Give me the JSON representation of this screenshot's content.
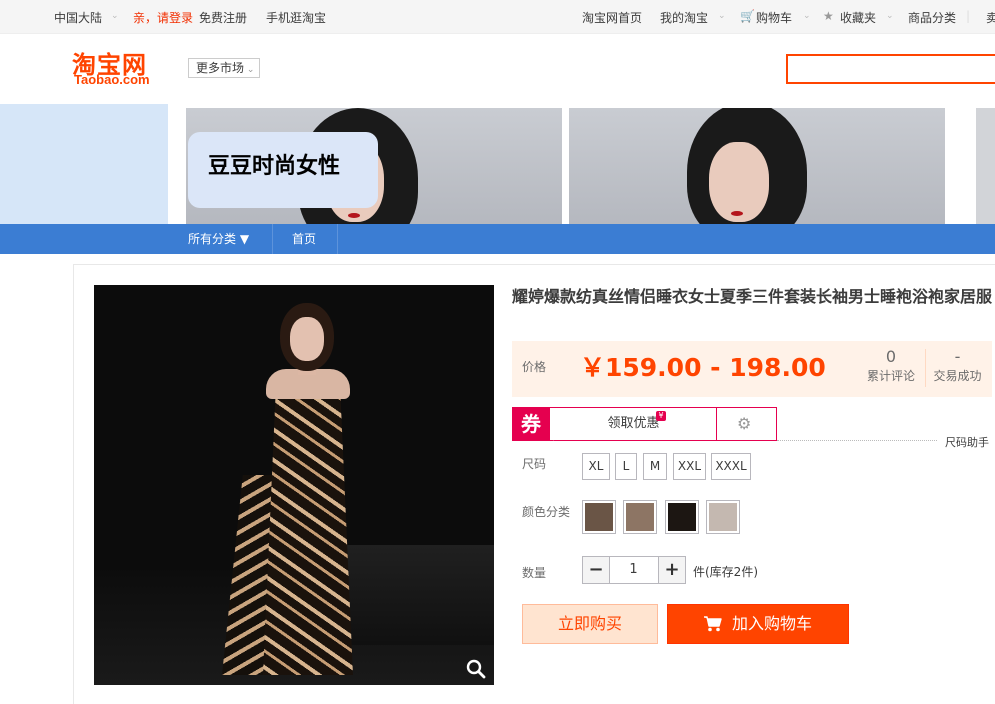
{
  "sitenav": {
    "region": "中国大陆",
    "login": "亲，请登录",
    "register": "免费注册",
    "mobile": "手机逛淘宝",
    "home": "淘宝网首页",
    "my_taobao": "我的淘宝",
    "cart": "购物车",
    "favorites": "收藏夹",
    "categories": "商品分类",
    "more": "卖"
  },
  "header": {
    "logo_cn": "淘宝网",
    "logo_en": "Taobao.com",
    "more_markets": "更多市场",
    "search_value": ""
  },
  "banner": {
    "shop_name": "豆豆时尚女性"
  },
  "shopnav": {
    "all_categories": "所有分类 ▼",
    "home": "首页"
  },
  "product": {
    "title": "耀婷爆款纺真丝情侣睡衣女士夏季三件套装长袖男士睡袍浴袍家居服",
    "price_label": "价格",
    "price": "￥159.00 - 198.00",
    "reviews_count": "0",
    "reviews_label": "累计评论",
    "sales_count": "-",
    "sales_label": "交易成功",
    "coupon_tag": "券",
    "coupon_get": "领取优惠",
    "coupon_mini": "¥",
    "size_help": "尺码助手",
    "size_label": "尺码",
    "sizes": [
      "XL",
      "L",
      "M",
      "XXL",
      "XXXL"
    ],
    "color_label": "颜色分类",
    "colors": [
      "#6a5546",
      "#8d7564",
      "#1c1612",
      "#c4b8b0"
    ],
    "qty_label": "数量",
    "qty_minus": "−",
    "qty_value": "1",
    "qty_plus": "+",
    "stock_text": "件(库存2件)",
    "buy_now": "立即购买",
    "add_cart": "加入购物车"
  },
  "colors": {
    "accent": "#ff4400",
    "nav_blue": "#3b7dd3",
    "coupon": "#e5004f"
  }
}
